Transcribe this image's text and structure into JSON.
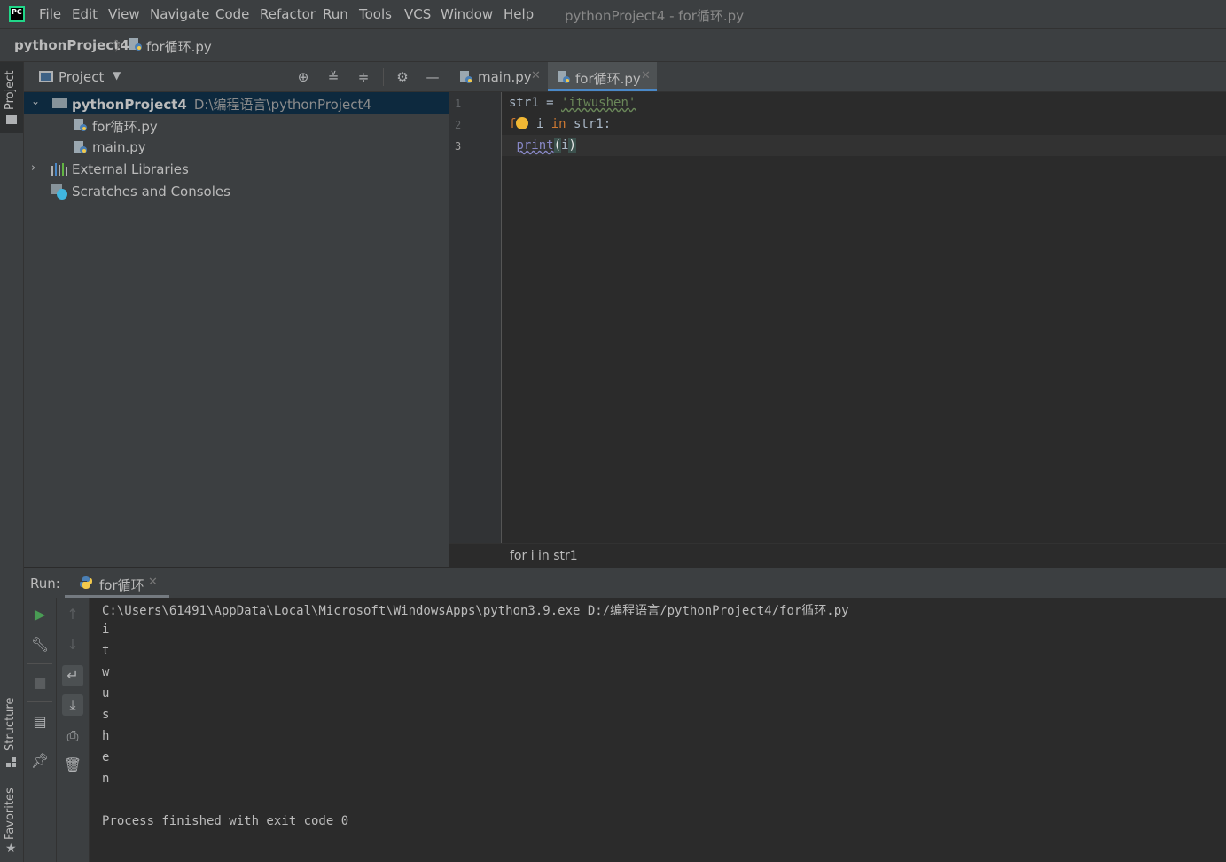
{
  "menubar": {
    "items": [
      {
        "label": "File",
        "underline": "F",
        "rest": "ile"
      },
      {
        "label": "Edit",
        "underline": "E",
        "rest": "dit"
      },
      {
        "label": "View",
        "underline": "V",
        "rest": "iew"
      },
      {
        "label": "Navigate",
        "underline": "N",
        "rest": "avigate"
      },
      {
        "label": "Code",
        "underline": "C",
        "rest": "ode"
      },
      {
        "label": "Refactor",
        "underline": "R",
        "rest": "efactor"
      },
      {
        "label": "Run",
        "underline": "",
        "rest": "Run"
      },
      {
        "label": "Tools",
        "underline": "T",
        "rest": "ools"
      },
      {
        "label": "VCS",
        "underline": "",
        "rest": "VCS"
      },
      {
        "label": "Window",
        "underline": "W",
        "rest": "indow"
      },
      {
        "label": "Help",
        "underline": "H",
        "rest": "elp"
      }
    ],
    "window_title": "pythonProject4 - for循环.py",
    "logo_text": "PC"
  },
  "breadcrumb": {
    "project": "pythonProject4",
    "separator": "〉",
    "file": "for循环.py"
  },
  "left_strip": {
    "project_tab": "Project",
    "structure_tab": "Structure",
    "favorites_tab": "Favorites"
  },
  "project_pane": {
    "title": "Project",
    "tree": {
      "root": {
        "name": "pythonProject4",
        "path": "D:\\编程语言\\pythonProject4"
      },
      "files": [
        "for循环.py",
        "main.py"
      ],
      "external_libraries": "External Libraries",
      "scratches": "Scratches and Consoles"
    }
  },
  "editor": {
    "tabs": [
      {
        "label": "main.py",
        "active": false
      },
      {
        "label": "for循环.py",
        "active": true
      }
    ],
    "line_numbers": [
      "1",
      "2",
      "3"
    ],
    "code": {
      "l1_var": "str1 = ",
      "l1_str": "'itwushen'",
      "l2_kw_f": "f",
      "l2_mid": " i ",
      "l2_kw_in": "in",
      "l2_end": " str1:",
      "l3_indent": " ",
      "l3_fn": "print",
      "l3_open": "(",
      "l3_arg": "i",
      "l3_close": ")"
    },
    "breadcrumb": "for i in str1"
  },
  "run_panel": {
    "label": "Run:",
    "tab_label": "for循环",
    "console_lines": [
      "C:\\Users\\61491\\AppData\\Local\\Microsoft\\WindowsApps\\python3.9.exe D:/编程语言/pythonProject4/for循环.py",
      "i",
      "t",
      "w",
      "u",
      "s",
      "h",
      "e",
      "n",
      "",
      "Process finished with exit code 0"
    ]
  },
  "colors": {
    "accent_tab": "#4a88c7",
    "string": "#6a8759",
    "keyword": "#cc7832",
    "builtin": "#8888c6",
    "run_green": "#499c54",
    "bulb": "#f2b834"
  }
}
